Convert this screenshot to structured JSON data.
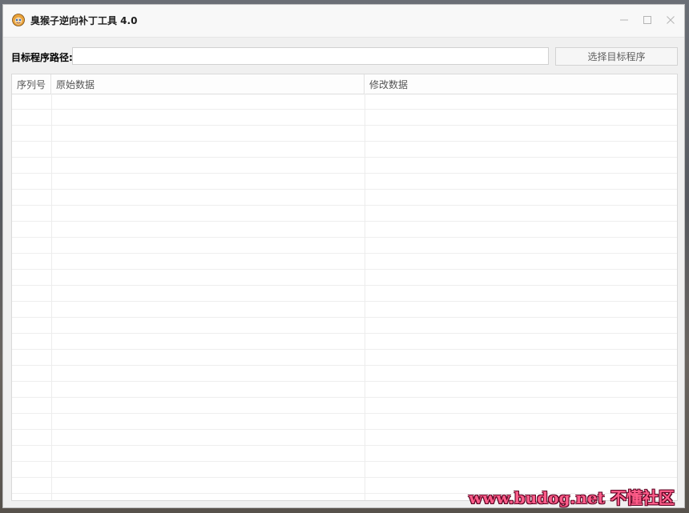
{
  "window": {
    "title": "臭猴子逆向补丁工具 4.0",
    "icon": "monkey-app-icon",
    "controls": {
      "minimize": "—",
      "maximize": "☐",
      "close": "✕"
    }
  },
  "path_row": {
    "label": "目标程序路径:",
    "input_value": "",
    "button_label": "选择目标程序"
  },
  "table": {
    "columns": [
      "序列号",
      "原始数据",
      "修改数据"
    ],
    "rows": []
  },
  "watermark": {
    "text": "www.budog.net 不懂社区"
  }
}
